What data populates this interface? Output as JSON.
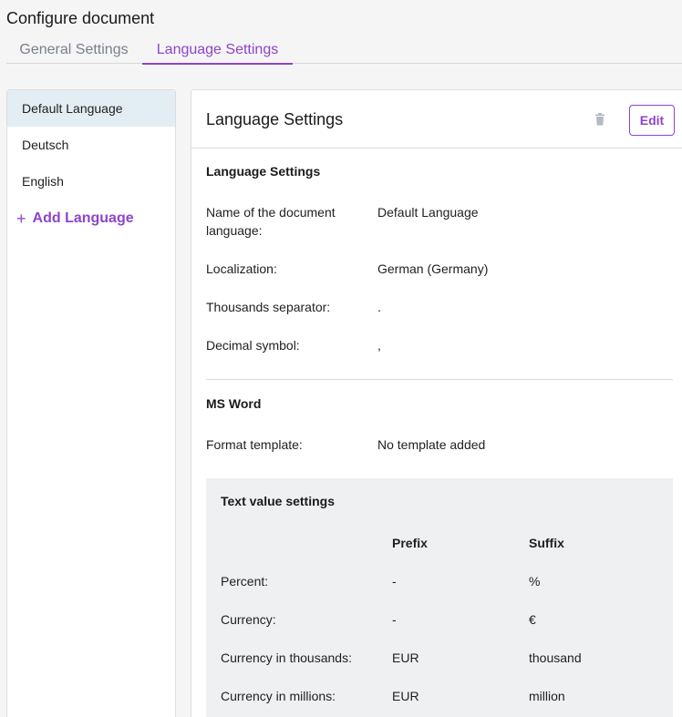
{
  "page": {
    "title": "Configure document"
  },
  "tabs": [
    {
      "label": "General Settings"
    },
    {
      "label": "Language Settings"
    }
  ],
  "sidebar": {
    "items": [
      {
        "label": "Default Language"
      },
      {
        "label": "Deutsch"
      },
      {
        "label": "English"
      }
    ],
    "add_label": "Add Language",
    "add_icon": "plus-icon"
  },
  "panel": {
    "title": "Language Settings",
    "edit_label": "Edit",
    "delete_icon": "trash-icon",
    "section1_title": "Language Settings",
    "fields": [
      {
        "label": "Name of the document language:",
        "value": "Default Language"
      },
      {
        "label": "Localization:",
        "value": "German (Germany)"
      },
      {
        "label": "Thousands separator:",
        "value": "."
      },
      {
        "label": "Decimal symbol:",
        "value": ","
      }
    ],
    "section2_title": "MS Word",
    "format_label": "Format template:",
    "format_value": "No template added",
    "text_value": {
      "title": "Text value settings",
      "prefix_header": "Prefix",
      "suffix_header": "Suffix",
      "rows": [
        {
          "label": "Percent:",
          "prefix": "-",
          "suffix": "%"
        },
        {
          "label": "Currency:",
          "prefix": "-",
          "suffix": "€"
        },
        {
          "label": "Currency in thousands:",
          "prefix": "EUR",
          "suffix": "thousand"
        },
        {
          "label": "Currency in millions:",
          "prefix": "EUR",
          "suffix": "million"
        }
      ]
    }
  },
  "colors": {
    "accent": "#8e44c9",
    "active_item_bg": "#e2eef4",
    "muted_tab": "#7a7f8c",
    "text_value_bg": "#eef0f2"
  }
}
